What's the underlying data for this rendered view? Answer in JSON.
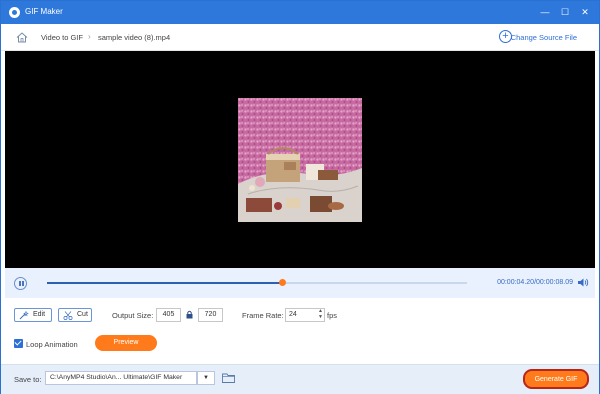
{
  "titlebar": {
    "title": "GIF Maker",
    "minimize": "—",
    "maximize": "☐",
    "close": "✕"
  },
  "nav": {
    "crumb_1": "Video to GIF",
    "crumb_2": "sample video (8).mp4",
    "separator": "›",
    "change_source": "Change Source File",
    "plus": "+"
  },
  "playback": {
    "progress": 0.56,
    "current_time": "00:00:04.20",
    "total_time": "00:00:08.09",
    "time_sep": "/"
  },
  "options": {
    "edit_label": "Edit",
    "cut_label": "Cut",
    "output_size_label": "Output Size:",
    "width": "405",
    "height": "720",
    "frame_rate_label": "Frame Rate:",
    "frame_rate": "24",
    "fps_label": "fps",
    "loop_label": "Loop Animation",
    "loop_checked": true,
    "preview_label": "Preview",
    "spin_up": "▲",
    "spin_down": "▼"
  },
  "footer": {
    "save_to_label": "Save to:",
    "save_path": "C:\\AnyMP4 Studio\\An... Ultimate\\GIF Maker",
    "dropdown_glyph": "▼",
    "generate_label": "Generate GIF"
  },
  "colors": {
    "accent": "#2e78dc",
    "orange": "#ff7a1a",
    "generate_border": "#b8261a"
  }
}
